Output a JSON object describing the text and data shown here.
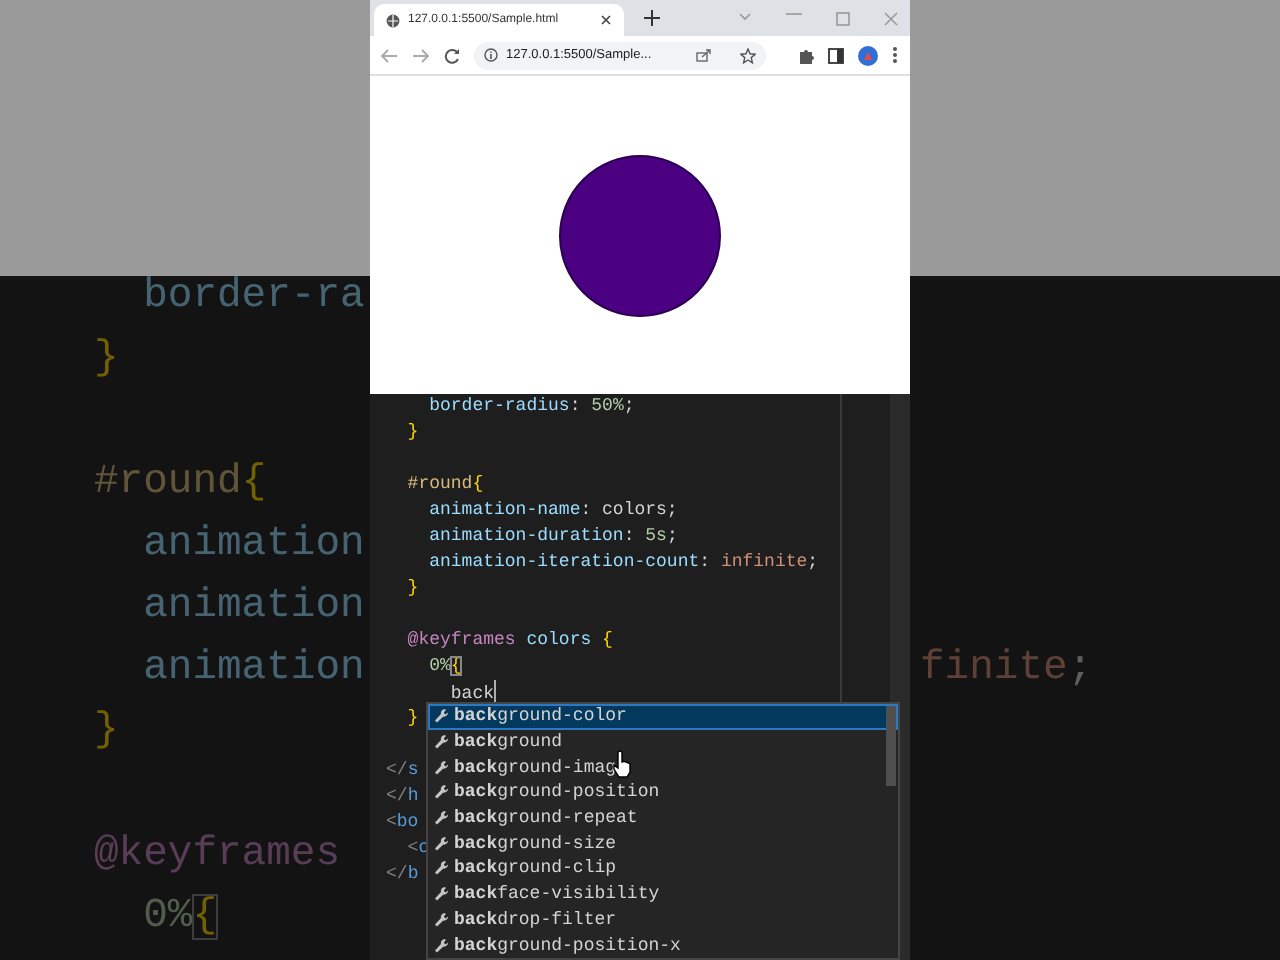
{
  "backdrop": {
    "left": [
      {
        "tokens": [
          {
            "text": "  border-ra",
            "kind": "prop"
          }
        ]
      },
      {
        "tokens": [
          {
            "text": "}",
            "kind": "brace"
          }
        ]
      },
      {
        "blank": true
      },
      {
        "tokens": [
          {
            "text": "#round",
            "kind": "sel"
          },
          {
            "text": "{",
            "kind": "brace"
          }
        ]
      },
      {
        "tokens": [
          {
            "text": "  animation",
            "kind": "prop"
          }
        ]
      },
      {
        "tokens": [
          {
            "text": "  animation",
            "kind": "prop"
          }
        ]
      },
      {
        "tokens": [
          {
            "text": "  animation",
            "kind": "prop"
          }
        ]
      },
      {
        "tokens": [
          {
            "text": "}",
            "kind": "brace"
          }
        ]
      },
      {
        "blank": true
      },
      {
        "tokens": [
          {
            "text": "@keyframes",
            "kind": "at"
          }
        ]
      },
      {
        "tokens": [
          {
            "text": "  0%",
            "kind": "num"
          },
          {
            "text": "{",
            "kind": "brace_match"
          }
        ]
      }
    ],
    "right": [
      {
        "blank": true
      },
      {
        "blank": true
      },
      {
        "blank": true
      },
      {
        "blank": true
      },
      {
        "blank": true
      },
      {
        "blank": true
      },
      {
        "tokens": [
          {
            "text": "finite",
            "kind": "value"
          },
          {
            "text": ";",
            "kind": "punct"
          }
        ]
      }
    ]
  },
  "browser": {
    "tab": {
      "title": "127.0.0.1:5500/Sample.html",
      "selected": true
    },
    "address": "127.0.0.1:5500/Sample..."
  },
  "editor": {
    "lines": [
      {
        "tokens": [
          {
            "text": "    border-radius",
            "kind": "prop"
          },
          {
            "text": ": ",
            "kind": "punct"
          },
          {
            "text": "50%",
            "kind": "num"
          },
          {
            "text": ";",
            "kind": "punct"
          }
        ]
      },
      {
        "tokens": [
          {
            "text": "  }",
            "kind": "brace"
          }
        ]
      },
      {
        "blank": true
      },
      {
        "tokens": [
          {
            "text": "  #round",
            "kind": "sel"
          },
          {
            "text": "{",
            "kind": "brace"
          }
        ]
      },
      {
        "tokens": [
          {
            "text": "    animation-name",
            "kind": "prop"
          },
          {
            "text": ": colors;",
            "kind": "punct"
          }
        ]
      },
      {
        "tokens": [
          {
            "text": "    animation-duration",
            "kind": "prop"
          },
          {
            "text": ": ",
            "kind": "punct"
          },
          {
            "text": "5s",
            "kind": "num"
          },
          {
            "text": ";",
            "kind": "punct"
          }
        ]
      },
      {
        "tokens": [
          {
            "text": "    animation-iteration-count",
            "kind": "prop"
          },
          {
            "text": ": ",
            "kind": "punct"
          },
          {
            "text": "infinite",
            "kind": "value"
          },
          {
            "text": ";",
            "kind": "punct"
          }
        ]
      },
      {
        "tokens": [
          {
            "text": "  }",
            "kind": "brace"
          }
        ]
      },
      {
        "blank": true
      },
      {
        "tokens": [
          {
            "text": "  @keyframes",
            "kind": "at"
          },
          {
            "text": " colors ",
            "kind": "ident"
          },
          {
            "text": "{",
            "kind": "brace"
          }
        ]
      },
      {
        "tokens": [
          {
            "text": "    0%",
            "kind": "num"
          },
          {
            "text": "{",
            "kind": "brace_match"
          }
        ]
      },
      {
        "tokens": [
          {
            "text": "      back",
            "kind": "punct"
          }
        ],
        "caret": true
      },
      {
        "tokens": [
          {
            "text": "  }",
            "kind": "brace"
          }
        ]
      },
      {
        "blank": true
      },
      {
        "tokens": [
          {
            "text": "</",
            "kind": "tag"
          },
          {
            "text": "s",
            "kind": "tagname"
          }
        ]
      },
      {
        "tokens": [
          {
            "text": "</",
            "kind": "tag"
          },
          {
            "text": "h",
            "kind": "tagname"
          }
        ]
      },
      {
        "tokens": [
          {
            "text": "<",
            "kind": "tag"
          },
          {
            "text": "bo",
            "kind": "tagname"
          }
        ]
      },
      {
        "tokens": [
          {
            "text": "  <",
            "kind": "tag"
          },
          {
            "text": "c",
            "kind": "tagname"
          }
        ]
      },
      {
        "tokens": [
          {
            "text": "</",
            "kind": "tag"
          },
          {
            "text": "b",
            "kind": "tagname"
          }
        ]
      }
    ],
    "suggestions": [
      {
        "label": "**back**ground-color",
        "selected": true
      },
      {
        "label": "**back**ground",
        "selected": false
      },
      {
        "label": "**back**ground-imag",
        "selected": false
      },
      {
        "label": "**back**ground-position",
        "selected": false
      },
      {
        "label": "**back**ground-repeat",
        "selected": false
      },
      {
        "label": "**back**ground-size",
        "selected": false
      },
      {
        "label": "**back**ground-clip",
        "selected": false
      },
      {
        "label": "**back**face-visibility",
        "selected": false
      },
      {
        "label": "**back**drop-filter",
        "selected": false
      },
      {
        "label": "**back**ground-position-x",
        "selected": false
      }
    ]
  }
}
